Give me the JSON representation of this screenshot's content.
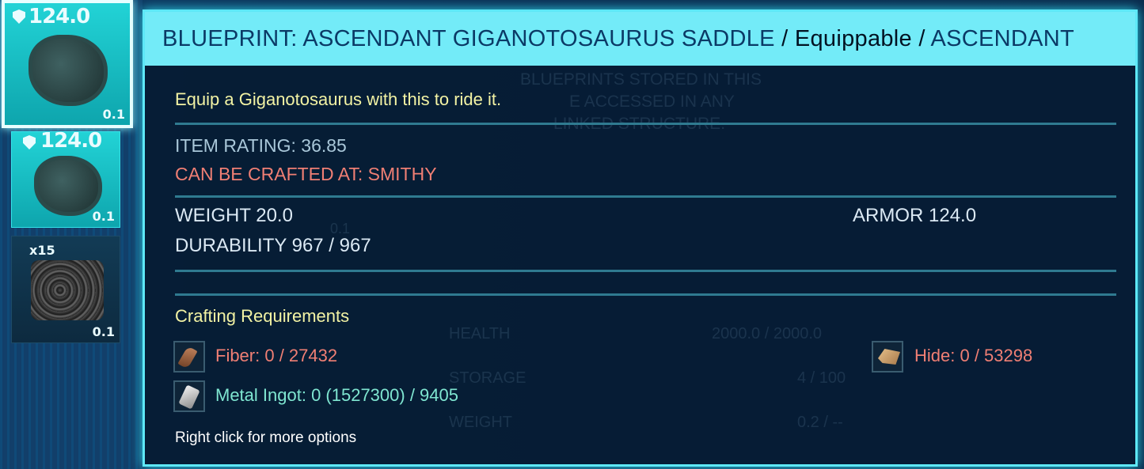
{
  "inventory": {
    "slots": [
      {
        "rating": "124.0",
        "weight": "0.1",
        "selected": true
      },
      {
        "rating": "124.0",
        "weight": "0.1",
        "selected": false
      },
      {
        "quantity": "x15",
        "weight": "0.1",
        "selected": false
      }
    ]
  },
  "background_text": {
    "notice_lines": [
      "BLUEPRINTS STORED IN THIS",
      "E ACCESSED IN ANY",
      "LINKED STRUCTURE."
    ],
    "stats": [
      {
        "label": "HEALTH",
        "value": "2000.0 / 2000.0"
      },
      {
        "label": "STORAGE",
        "value": "4 / 100"
      },
      {
        "label": "WEIGHT",
        "value": "0.2 / --"
      }
    ],
    "partial_slot_value": "0.1",
    "left_partial": "12"
  },
  "tooltip": {
    "title_main": "BLUEPRINT: ASCENDANT GIGANOTOSAURUS SADDLE",
    "sep1": " / ",
    "type": "Equippable",
    "sep2": " / ",
    "quality": "ASCENDANT",
    "description": "Equip a Giganotosaurus with this to ride it.",
    "item_rating": "ITEM RATING: 36.85",
    "crafted_at": "CAN BE CRAFTED AT: SMITHY",
    "weight": "WEIGHT 20.0",
    "armor": "ARMOR 124.0",
    "durability": "DURABILITY 967 / 967",
    "crafting_header": "Crafting Requirements",
    "requirements": [
      {
        "name": "Fiber: 0 / 27432",
        "icon": "fiber-icon"
      },
      {
        "name": "Hide: 0 / 53298",
        "icon": "hide-icon"
      },
      {
        "name": "Metal Ingot: 0 (1527300) / 9405",
        "icon": "metal-ingot-icon"
      }
    ],
    "hint": "Right click for more options"
  },
  "colors": {
    "header_bg": "#73ebf8",
    "panel_bg": "#061c34",
    "missing_resource": "#f07f74",
    "available_resource": "#7fe6d1",
    "description": "#f3f3a4"
  }
}
